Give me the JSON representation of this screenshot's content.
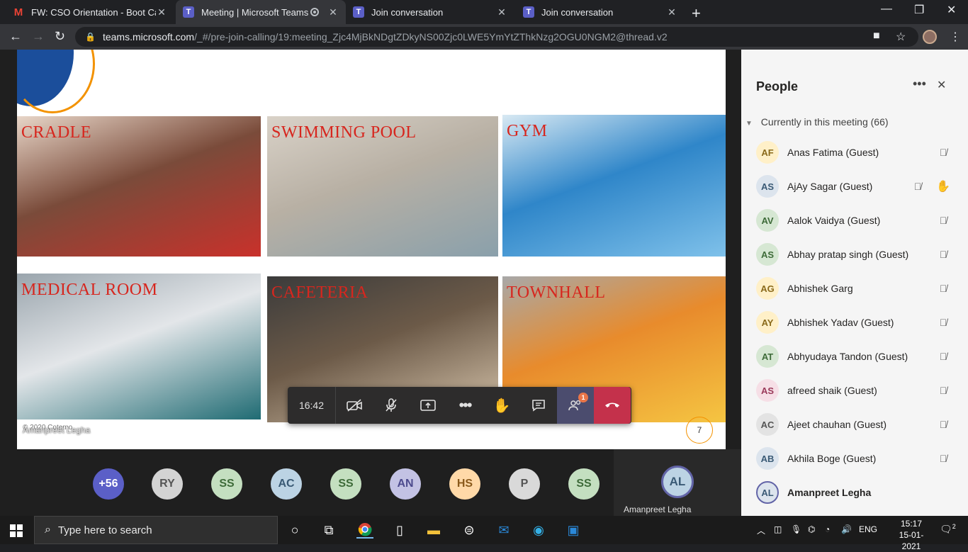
{
  "browser": {
    "tabs": [
      {
        "title": "FW: CSO Orientation - Boot Cam",
        "icon": "gmail-icon"
      },
      {
        "title": "Meeting | Microsoft Teams",
        "icon": "teams-icon",
        "active": true
      },
      {
        "title": "Join conversation",
        "icon": "teams-icon"
      },
      {
        "title": "Join conversation",
        "icon": "teams-icon"
      }
    ],
    "url_host": "teams.microsoft.com",
    "url_path": "/_#/pre-join-calling/19:meeting_Zjc4MjBkNDgtZDkyNS00Zjc0LWE5YmYtZThkNzg2OGU0NGM2@thread.v2"
  },
  "slide": {
    "photos": [
      {
        "caption": "CRADLE",
        "colors": [
          "#7a4b3a",
          "#c9312b",
          "#e8d6c8"
        ]
      },
      {
        "caption": "SWIMMING POOL",
        "colors": [
          "#b8b0a4",
          "#8aa0ab",
          "#d9d2c8"
        ]
      },
      {
        "caption": "GYM",
        "colors": [
          "#2f86c9",
          "#7fc1ea",
          "#d8e9f3"
        ]
      },
      {
        "caption": "MEDICAL ROOM",
        "colors": [
          "#e3e6e9",
          "#1f6b73",
          "#9aa5ad"
        ]
      },
      {
        "caption": "CAFETERIA",
        "colors": [
          "#6c5a48",
          "#d9c7ae",
          "#3b3b3b"
        ]
      },
      {
        "caption": "TOWNHALL",
        "colors": [
          "#e88b2c",
          "#f5c542",
          "#a8a8a8"
        ]
      }
    ],
    "footer": "© 2020 Cotemo",
    "page_number": "7"
  },
  "presenter_label": "Amanpreet Legha",
  "call_controls": {
    "timer": "16:42",
    "people_badge": "1"
  },
  "participants_strip": [
    {
      "initials": "+56"
    },
    {
      "initials": "RY"
    },
    {
      "initials": "SS"
    },
    {
      "initials": "AC"
    },
    {
      "initials": "SS"
    },
    {
      "initials": "AN"
    },
    {
      "initials": "HS"
    },
    {
      "initials": "P"
    },
    {
      "initials": "SS"
    }
  ],
  "presenter_tile": {
    "initials": "AL",
    "name": "Amanpreet Legha"
  },
  "people_panel": {
    "title": "People",
    "section": "Currently in this meeting (66)",
    "people": [
      {
        "initials": "AF",
        "name": "Anas Fatima (Guest)",
        "bg": "#fff0c8",
        "fg": "#8a6a1b"
      },
      {
        "initials": "AS",
        "name": "AjAy Sagar (Guest)",
        "bg": "#dce4ed",
        "fg": "#3a5a75",
        "hand": true
      },
      {
        "initials": "AV",
        "name": "Aalok Vaidya (Guest)",
        "bg": "#d6e7d3",
        "fg": "#3e6b39"
      },
      {
        "initials": "AS",
        "name": "Abhay pratap singh (Guest)",
        "bg": "#d6e7d3",
        "fg": "#3e6b39"
      },
      {
        "initials": "AG",
        "name": "Abhishek Garg",
        "bg": "#fff0c8",
        "fg": "#8a6a1b"
      },
      {
        "initials": "AY",
        "name": "Abhishek Yadav (Guest)",
        "bg": "#fff0c8",
        "fg": "#8a6a1b"
      },
      {
        "initials": "AT",
        "name": "Abhyudaya Tandon (Guest)",
        "bg": "#d6e7d3",
        "fg": "#3e6b39"
      },
      {
        "initials": "AS",
        "name": "afreed shaik (Guest)",
        "bg": "#f6dfe6",
        "fg": "#9a3a5a"
      },
      {
        "initials": "AC",
        "name": "Ajeet chauhan (Guest)",
        "bg": "#e3e3e3",
        "fg": "#555555"
      },
      {
        "initials": "AB",
        "name": "Akhila Boge (Guest)",
        "bg": "#dce4ed",
        "fg": "#3a5a75"
      },
      {
        "initials": "AL",
        "name": "Amanpreet Legha",
        "bg": "#dce4ed",
        "fg": "#3a5a75",
        "bold": true
      }
    ]
  },
  "taskbar": {
    "search_placeholder": "Type here to search",
    "language": "ENG",
    "time": "15:17",
    "date": "15-01-2021",
    "notifications": "2"
  }
}
